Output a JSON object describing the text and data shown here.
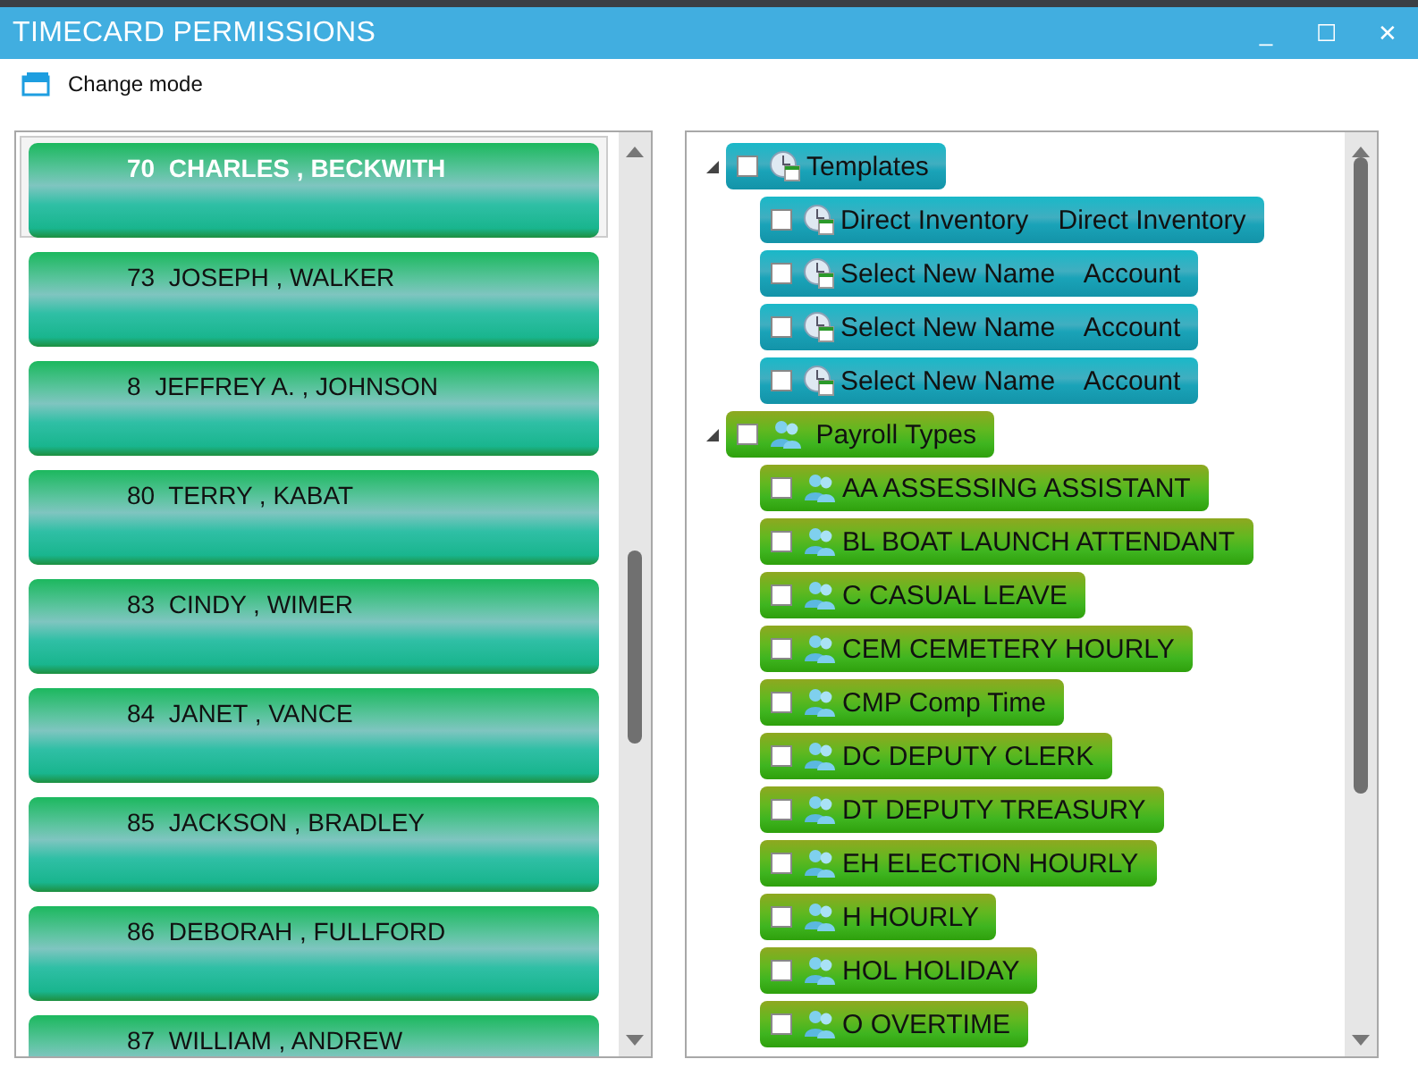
{
  "window": {
    "title": "TIMECARD PERMISSIONS",
    "controls": [
      "_",
      "☐",
      "✕"
    ]
  },
  "toolbar": {
    "change_mode": "Change mode"
  },
  "employees": [
    {
      "label": "70  CHARLES , BECKWITH",
      "selected": true
    },
    {
      "label": "73  JOSEPH , WALKER",
      "selected": false
    },
    {
      "label": "8  JEFFREY A. , JOHNSON",
      "selected": false
    },
    {
      "label": "80  TERRY , KABAT",
      "selected": false
    },
    {
      "label": "83  CINDY , WIMER",
      "selected": false
    },
    {
      "label": "84  JANET , VANCE",
      "selected": false
    },
    {
      "label": "85  JACKSON , BRADLEY",
      "selected": false
    },
    {
      "label": "86  DEBORAH , FULLFORD",
      "selected": false
    },
    {
      "label": "87  WILLIAM , ANDREW",
      "selected": false
    }
  ],
  "tree": [
    {
      "label": "Templates",
      "kind": "template",
      "expanded": true,
      "checked": false,
      "children": [
        {
          "label": "Direct Inventory    Direct Inventory",
          "kind": "template",
          "checked": false
        },
        {
          "label": "Select New Name    Account",
          "kind": "template",
          "checked": false
        },
        {
          "label": "Select New Name    Account",
          "kind": "template",
          "checked": false
        },
        {
          "label": "Select New Name    Account",
          "kind": "template",
          "checked": false
        }
      ]
    },
    {
      "label": " Payroll Types",
      "kind": "payroll",
      "expanded": true,
      "checked": false,
      "children": [
        {
          "label": "AA ASSESSING ASSISTANT",
          "kind": "payroll",
          "checked": false
        },
        {
          "label": "BL BOAT LAUNCH ATTENDANT",
          "kind": "payroll",
          "checked": false
        },
        {
          "label": "C CASUAL LEAVE",
          "kind": "payroll",
          "checked": false
        },
        {
          "label": "CEM CEMETERY HOURLY",
          "kind": "payroll",
          "checked": false
        },
        {
          "label": "CMP Comp Time",
          "kind": "payroll",
          "checked": false
        },
        {
          "label": "DC DEPUTY CLERK",
          "kind": "payroll",
          "checked": false
        },
        {
          "label": "DT DEPUTY TREASURY",
          "kind": "payroll",
          "checked": false
        },
        {
          "label": "EH ELECTION HOURLY",
          "kind": "payroll",
          "checked": false
        },
        {
          "label": "H HOURLY",
          "kind": "payroll",
          "checked": false
        },
        {
          "label": "HOL HOLIDAY",
          "kind": "payroll",
          "checked": false
        },
        {
          "label": "O OVERTIME",
          "kind": "payroll",
          "checked": false
        }
      ]
    }
  ]
}
